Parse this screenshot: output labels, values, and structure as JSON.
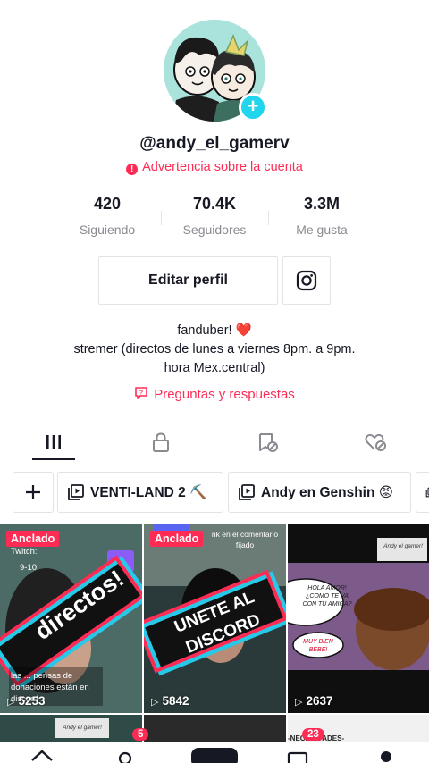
{
  "profile": {
    "username": "@andy_el_gamerv",
    "warning": "Advertencia sobre la cuenta"
  },
  "stats": [
    {
      "value": "420",
      "label": "Siguiendo"
    },
    {
      "value": "70.4K",
      "label": "Seguidores"
    },
    {
      "value": "3.3M",
      "label": "Me gusta"
    }
  ],
  "actions": {
    "edit_label": "Editar perfil",
    "instagram_icon": "instagram-icon"
  },
  "bio": {
    "line1": "fanduber!",
    "line1_emoji": "❤️",
    "line2": "stremer (directos de lunes a viernes 8pm. a 9pm.",
    "line3": "hora Mex.central)"
  },
  "qa_label": "Preguntas y respuestas",
  "tabs": [
    "videos-grid-icon",
    "lock-icon",
    "saved-icon",
    "liked-icon"
  ],
  "playlists": [
    {
      "label": "VENTI-LAND 2 ⛏️"
    },
    {
      "label": "Andy en Genshin 😡"
    }
  ],
  "videos": [
    {
      "pinned": "Anclado",
      "views": "5253",
      "overlay": "directos!",
      "top_text": "Twitch:",
      "top_time": "9-10",
      "caption": "las ... pensas de donaciones están en discord"
    },
    {
      "pinned": "Anclado",
      "views": "5842",
      "overlay": "UNETE AL DISCORD",
      "top_text": "nk en el comentario fijado"
    },
    {
      "views": "2637",
      "bubble1": "HOLA AMOR! ¿COMO TE VA CON TU AMIGA?",
      "bubble2": "MUY BIEN BEBE!",
      "tag": "Andy el gamer!"
    }
  ],
  "next_row": {
    "tag": "Andy el gamer!",
    "text": "-NECESIDADES-"
  },
  "nav_badges": {
    "inbox": "23",
    "friends": "5"
  },
  "colors": {
    "accent": "#fe2c55",
    "avatar_bg": "#a9e3dc",
    "add_button": "#20d5ec"
  }
}
